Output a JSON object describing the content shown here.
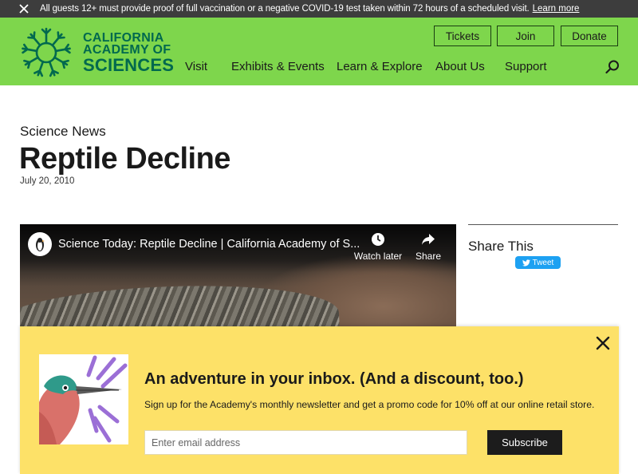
{
  "alert": {
    "text": "All guests 12+ must provide proof of full vaccination or a negative COVID-19 test taken within 72 hours of a scheduled visit.",
    "link_label": "Learn more",
    "close_icon": "close-icon"
  },
  "header": {
    "logo": {
      "line1": "CALIFORNIA",
      "line2": "ACADEMY OF",
      "line3": "SCIENCES",
      "color": "#00694e"
    },
    "background_color": "#7ed64c",
    "utility_buttons": {
      "tickets": "Tickets",
      "join": "Join",
      "donate": "Donate"
    },
    "nav": {
      "visit": "Visit",
      "exhibits": "Exhibits & Events",
      "learn": "Learn & Explore",
      "about": "About Us",
      "support": "Support"
    },
    "search_icon": "search-icon"
  },
  "article": {
    "eyebrow": "Science News",
    "title": "Reptile Decline",
    "date": "July 20, 2010"
  },
  "video": {
    "title": "Science Today: Reptile Decline | California Academy of S...",
    "watch_later": "Watch later",
    "share": "Share"
  },
  "share": {
    "title": "Share This",
    "tweet_label": "Tweet",
    "tweet_color": "#1da1f2"
  },
  "promo": {
    "heading": "An adventure in your inbox. (And a discount, too.)",
    "subheading": "Sign up for the Academy's monthly newsletter and get a promo code for 10% off at our online retail store.",
    "email_placeholder": "Enter email address",
    "subscribe_label": "Subscribe",
    "background_color": "#fde168"
  }
}
